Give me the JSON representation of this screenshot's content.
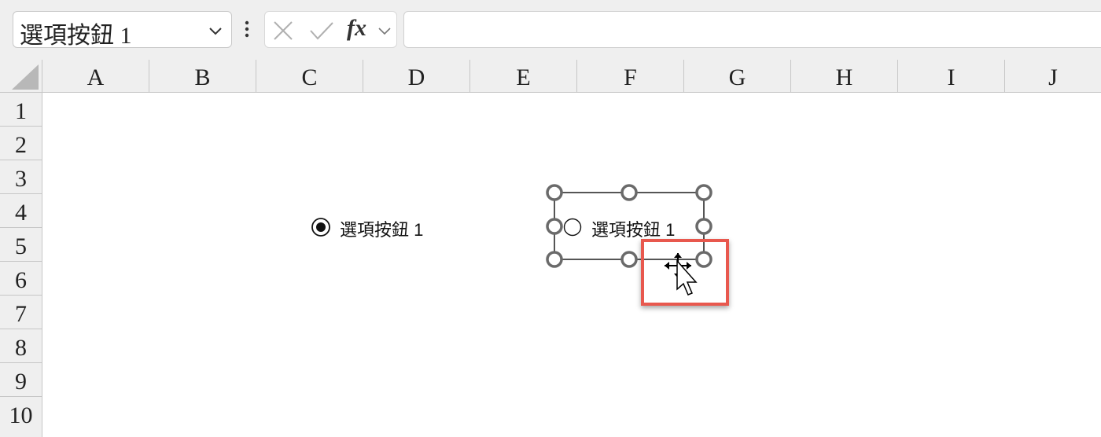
{
  "name_box": {
    "value": "選項按鈕  1"
  },
  "formula_bar": {
    "fx_label": "fx",
    "cancel_icon": "close-icon",
    "enter_icon": "checkmark-icon",
    "value": ""
  },
  "columns": [
    "A",
    "B",
    "C",
    "D",
    "E",
    "F",
    "G",
    "H",
    "I",
    "J"
  ],
  "rows": [
    "1",
    "2",
    "3",
    "4",
    "5",
    "6",
    "7",
    "8",
    "9",
    "10"
  ],
  "controls": {
    "radio_button_1": {
      "label": "選項按鈕 1",
      "checked": true
    },
    "radio_button_2": {
      "label": "選項按鈕 1",
      "checked": false,
      "selected_for_editing": true
    }
  },
  "colors": {
    "highlight": "#e8584e",
    "header_bg": "#efefef",
    "gridline": "#c6c6c6"
  },
  "cursor": "move-cursor-icon"
}
